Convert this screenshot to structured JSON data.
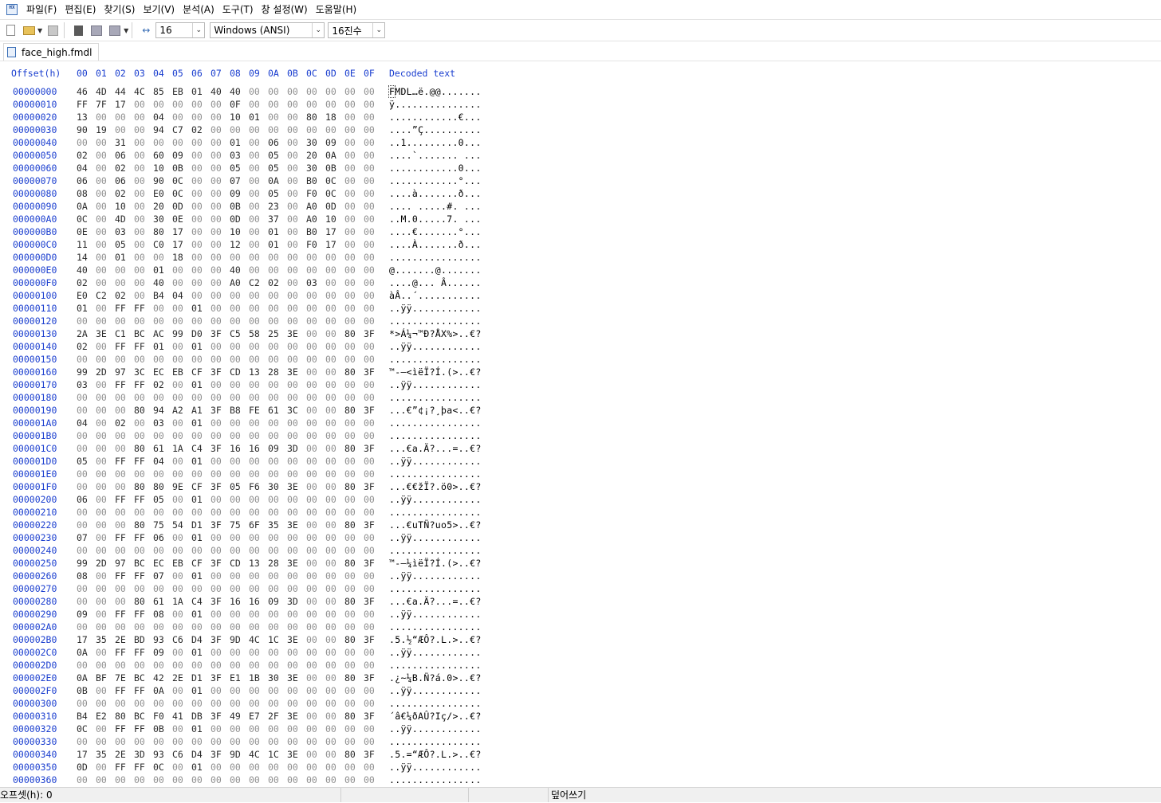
{
  "menubar": {
    "items": [
      "파일(F)",
      "편집(E)",
      "찾기(S)",
      "보기(V)",
      "분석(A)",
      "도구(T)",
      "창 설정(W)",
      "도움말(H)"
    ]
  },
  "toolbar": {
    "bytes_per_row": "16",
    "encoding": "Windows (ANSI)",
    "number_base": "16진수"
  },
  "tab": {
    "filename": "face_high.fmdl"
  },
  "hex": {
    "offset_header": "Offset(h)",
    "column_headers": [
      "00",
      "01",
      "02",
      "03",
      "04",
      "05",
      "06",
      "07",
      "08",
      "09",
      "0A",
      "0B",
      "0C",
      "0D",
      "0E",
      "0F"
    ],
    "decoded_header": "Decoded text",
    "rows": [
      {
        "o": "00000000",
        "b": "46 4D 44 4C 85 EB 01 40 40 00 00 00 00 00 00 00",
        "t": "FMDL…ë.@@......."
      },
      {
        "o": "00000010",
        "b": "FF 7F 17 00 00 00 00 00 0F 00 00 00 00 00 00 00",
        "t": "ÿ..............."
      },
      {
        "o": "00000020",
        "b": "13 00 00 00 04 00 00 00 10 01 00 00 80 18 00 00",
        "t": "............€..."
      },
      {
        "o": "00000030",
        "b": "90 19 00 00 94 C7 02 00 00 00 00 00 00 00 00 00",
        "t": "....”Ç.........."
      },
      {
        "o": "00000040",
        "b": "00 00 31 00 00 00 00 00 01 00 06 00 30 09 00 00",
        "t": "..1.........0..."
      },
      {
        "o": "00000050",
        "b": "02 00 06 00 60 09 00 00 03 00 05 00 20 0A 00 00",
        "t": "....`....... ..."
      },
      {
        "o": "00000060",
        "b": "04 00 02 00 10 0B 00 00 05 00 05 00 30 0B 00 00",
        "t": "............0..."
      },
      {
        "o": "00000070",
        "b": "06 00 06 00 90 0C 00 00 07 00 0A 00 B0 0C 00 00",
        "t": "............°..."
      },
      {
        "o": "00000080",
        "b": "08 00 02 00 E0 0C 00 00 09 00 05 00 F0 0C 00 00",
        "t": "....à.......ð..."
      },
      {
        "o": "00000090",
        "b": "0A 00 10 00 20 0D 00 00 0B 00 23 00 A0 0D 00 00",
        "t": ".... .....#. ..."
      },
      {
        "o": "000000A0",
        "b": "0C 00 4D 00 30 0E 00 00 0D 00 37 00 A0 10 00 00",
        "t": "..M.0.....7. ..."
      },
      {
        "o": "000000B0",
        "b": "0E 00 03 00 80 17 00 00 10 00 01 00 B0 17 00 00",
        "t": "....€.......°..."
      },
      {
        "o": "000000C0",
        "b": "11 00 05 00 C0 17 00 00 12 00 01 00 F0 17 00 00",
        "t": "....À.......ð..."
      },
      {
        "o": "000000D0",
        "b": "14 00 01 00 00 18 00 00 00 00 00 00 00 00 00 00",
        "t": "................"
      },
      {
        "o": "000000E0",
        "b": "40 00 00 00 01 00 00 00 40 00 00 00 00 00 00 00",
        "t": "@.......@......."
      },
      {
        "o": "000000F0",
        "b": "02 00 00 00 40 00 00 00 A0 C2 02 00 03 00 00 00",
        "t": "....@... Â......"
      },
      {
        "o": "00000100",
        "b": "E0 C2 02 00 B4 04 00 00 00 00 00 00 00 00 00 00",
        "t": "àÂ..´..........."
      },
      {
        "o": "00000110",
        "b": "01 00 FF FF 00 00 01 00 00 00 00 00 00 00 00 00",
        "t": "..ÿÿ............"
      },
      {
        "o": "00000120",
        "b": "00 00 00 00 00 00 00 00 00 00 00 00 00 00 00 00",
        "t": "................"
      },
      {
        "o": "00000130",
        "b": "2A 3E C1 BC AC 99 D0 3F C5 58 25 3E 00 00 80 3F",
        "t": "*>Á¼¬™Ð?ÅX%>..€?"
      },
      {
        "o": "00000140",
        "b": "02 00 FF FF 01 00 01 00 00 00 00 00 00 00 00 00",
        "t": "..ÿÿ............"
      },
      {
        "o": "00000150",
        "b": "00 00 00 00 00 00 00 00 00 00 00 00 00 00 00 00",
        "t": "................"
      },
      {
        "o": "00000160",
        "b": "99 2D 97 3C EC EB CF 3F CD 13 28 3E 00 00 80 3F",
        "t": "™-—<ìëÏ?Í.(>..€?"
      },
      {
        "o": "00000170",
        "b": "03 00 FF FF 02 00 01 00 00 00 00 00 00 00 00 00",
        "t": "..ÿÿ............"
      },
      {
        "o": "00000180",
        "b": "00 00 00 00 00 00 00 00 00 00 00 00 00 00 00 00",
        "t": "................"
      },
      {
        "o": "00000190",
        "b": "00 00 00 80 94 A2 A1 3F B8 FE 61 3C 00 00 80 3F",
        "t": "...€”¢¡?¸þa<..€?"
      },
      {
        "o": "000001A0",
        "b": "04 00 02 00 03 00 01 00 00 00 00 00 00 00 00 00",
        "t": "................"
      },
      {
        "o": "000001B0",
        "b": "00 00 00 00 00 00 00 00 00 00 00 00 00 00 00 00",
        "t": "................"
      },
      {
        "o": "000001C0",
        "b": "00 00 00 80 61 1A C4 3F 16 16 09 3D 00 00 80 3F",
        "t": "...€a.Ä?...=..€?"
      },
      {
        "o": "000001D0",
        "b": "05 00 FF FF 04 00 01 00 00 00 00 00 00 00 00 00",
        "t": "..ÿÿ............"
      },
      {
        "o": "000001E0",
        "b": "00 00 00 00 00 00 00 00 00 00 00 00 00 00 00 00",
        "t": "................"
      },
      {
        "o": "000001F0",
        "b": "00 00 00 80 80 9E CF 3F 05 F6 30 3E 00 00 80 3F",
        "t": "...€€žÏ?.ö0>..€?"
      },
      {
        "o": "00000200",
        "b": "06 00 FF FF 05 00 01 00 00 00 00 00 00 00 00 00",
        "t": "..ÿÿ............"
      },
      {
        "o": "00000210",
        "b": "00 00 00 00 00 00 00 00 00 00 00 00 00 00 00 00",
        "t": "................"
      },
      {
        "o": "00000220",
        "b": "00 00 00 80 75 54 D1 3F 75 6F 35 3E 00 00 80 3F",
        "t": "...€uTÑ?uo5>..€?"
      },
      {
        "o": "00000230",
        "b": "07 00 FF FF 06 00 01 00 00 00 00 00 00 00 00 00",
        "t": "..ÿÿ............"
      },
      {
        "o": "00000240",
        "b": "00 00 00 00 00 00 00 00 00 00 00 00 00 00 00 00",
        "t": "................"
      },
      {
        "o": "00000250",
        "b": "99 2D 97 BC EC EB CF 3F CD 13 28 3E 00 00 80 3F",
        "t": "™-—¼ìëÏ?Í.(>..€?"
      },
      {
        "o": "00000260",
        "b": "08 00 FF FF 07 00 01 00 00 00 00 00 00 00 00 00",
        "t": "..ÿÿ............"
      },
      {
        "o": "00000270",
        "b": "00 00 00 00 00 00 00 00 00 00 00 00 00 00 00 00",
        "t": "................"
      },
      {
        "o": "00000280",
        "b": "00 00 00 80 61 1A C4 3F 16 16 09 3D 00 00 80 3F",
        "t": "...€a.Ä?...=..€?"
      },
      {
        "o": "00000290",
        "b": "09 00 FF FF 08 00 01 00 00 00 00 00 00 00 00 00",
        "t": "..ÿÿ............"
      },
      {
        "o": "000002A0",
        "b": "00 00 00 00 00 00 00 00 00 00 00 00 00 00 00 00",
        "t": "................"
      },
      {
        "o": "000002B0",
        "b": "17 35 2E BD 93 C6 D4 3F 9D 4C 1C 3E 00 00 80 3F",
        "t": ".5.½“ÆÔ?.L.>..€?"
      },
      {
        "o": "000002C0",
        "b": "0A 00 FF FF 09 00 01 00 00 00 00 00 00 00 00 00",
        "t": "..ÿÿ............"
      },
      {
        "o": "000002D0",
        "b": "00 00 00 00 00 00 00 00 00 00 00 00 00 00 00 00",
        "t": "................"
      },
      {
        "o": "000002E0",
        "b": "0A BF 7E BC 42 2E D1 3F E1 1B 30 3E 00 00 80 3F",
        "t": ".¿~¼B.Ñ?á.0>..€?"
      },
      {
        "o": "000002F0",
        "b": "0B 00 FF FF 0A 00 01 00 00 00 00 00 00 00 00 00",
        "t": "..ÿÿ............"
      },
      {
        "o": "00000300",
        "b": "00 00 00 00 00 00 00 00 00 00 00 00 00 00 00 00",
        "t": "................"
      },
      {
        "o": "00000310",
        "b": "B4 E2 80 BC F0 41 DB 3F 49 E7 2F 3E 00 00 80 3F",
        "t": "´â€¼ðAÛ?Iç/>..€?"
      },
      {
        "o": "00000320",
        "b": "0C 00 FF FF 0B 00 01 00 00 00 00 00 00 00 00 00",
        "t": "..ÿÿ............"
      },
      {
        "o": "00000330",
        "b": "00 00 00 00 00 00 00 00 00 00 00 00 00 00 00 00",
        "t": "................"
      },
      {
        "o": "00000340",
        "b": "17 35 2E 3D 93 C6 D4 3F 9D 4C 1C 3E 00 00 80 3F",
        "t": ".5.=“ÆÔ?.L.>..€?"
      },
      {
        "o": "00000350",
        "b": "0D 00 FF FF 0C 00 01 00 00 00 00 00 00 00 00 00",
        "t": "..ÿÿ............"
      },
      {
        "o": "00000360",
        "b": "00 00 00 00 00 00 00 00 00 00 00 00 00 00 00 00",
        "t": "................"
      }
    ]
  },
  "statusbar": {
    "offset": "오프셋(h): 0",
    "mode": "덮어쓰기"
  }
}
